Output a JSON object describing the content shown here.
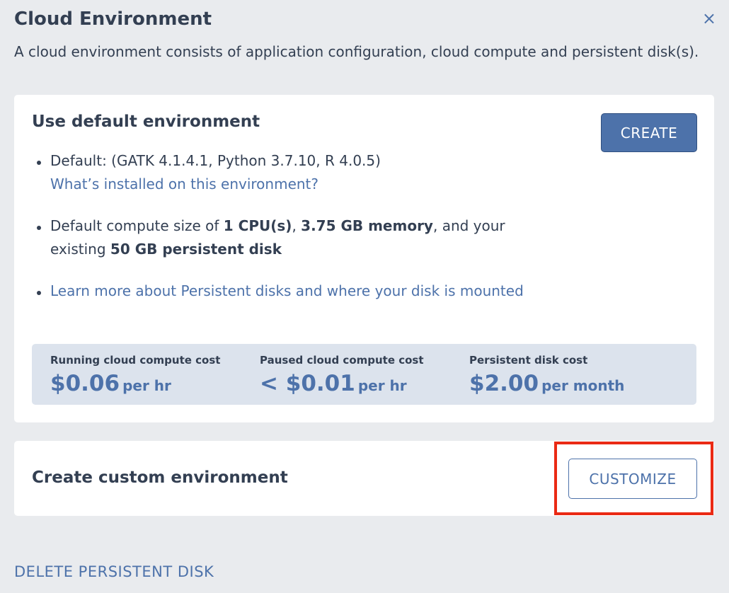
{
  "dialog": {
    "title": "Cloud Environment",
    "close_icon": "×",
    "subtitle": "A cloud environment consists of application configuration, cloud compute and persistent disk(s)."
  },
  "default_env": {
    "title": "Use default environment",
    "create_label": "CREATE",
    "bullet1": {
      "text": "Default: (GATK 4.1.4.1, Python 3.7.10, R 4.0.5)",
      "link": "What’s installed on this environment?"
    },
    "bullet2": {
      "prefix": "Default compute size of ",
      "cpu": "1 CPU(s)",
      "sep": ", ",
      "memory": "3.75 GB memory",
      "middle": ", and your existing ",
      "disk": "50 GB persistent disk"
    },
    "bullet3": {
      "link": "Learn more about Persistent disks and where your disk is mounted"
    },
    "costs": [
      {
        "label": "Running cloud compute cost",
        "amount": "$0.06",
        "unit": "per hr"
      },
      {
        "label": "Paused cloud compute cost",
        "amount": "< $0.01",
        "unit": "per hr"
      },
      {
        "label": "Persistent disk cost",
        "amount": "$2.00",
        "unit": "per month"
      }
    ]
  },
  "custom_env": {
    "title": "Create custom environment",
    "customize_label": "CUSTOMIZE"
  },
  "footer": {
    "delete_label": "DELETE PERSISTENT DISK"
  },
  "colors": {
    "accent": "#4d72aa",
    "highlight": "#ea2a14",
    "background": "#e9ebee",
    "cost_box": "#dce3ed"
  }
}
